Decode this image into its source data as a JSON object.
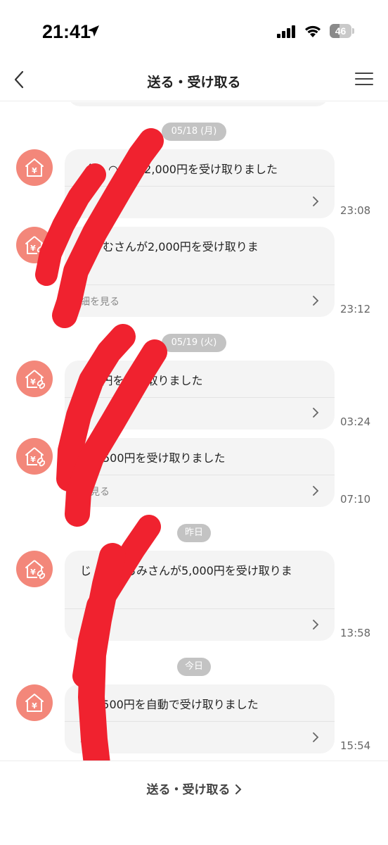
{
  "status_bar": {
    "time": "21:41",
    "battery_level": 46,
    "battery_text": "46",
    "location_icon": "location-arrow-icon",
    "signal_icon": "cellular-signal-icon",
    "wifi_icon": "wifi-icon"
  },
  "nav": {
    "title": "送る・受け取る",
    "back_icon": "chevron-left-icon",
    "menu_icon": "hamburger-menu-icon"
  },
  "colors": {
    "accent": "#f3877a",
    "card_bg": "#f4f4f4",
    "date_pill": "#c3c3c3",
    "scribble": "#f0222f"
  },
  "feed": {
    "dates": [
      "05/18 (月)",
      "05/19 (火)",
      "昨日",
      "今日"
    ],
    "messages": [
      {
        "text": "（ ◠ ◠ ）が2,000円を受け取りました",
        "link": "",
        "time": "23:08",
        "avatar_icon": "yen-house-icon"
      },
      {
        "text": "ちゃむさんが2,000円を受け取りま",
        "link": "細を見る",
        "time": "23:12",
        "avatar_icon": "yen-house-link-icon"
      },
      {
        "text": "000円を受け取りました",
        "link": "",
        "time": "03:24",
        "avatar_icon": "yen-house-link-icon"
      },
      {
        "text": "んが500円を受け取りました",
        "link": "を見る",
        "time": "07:10",
        "avatar_icon": "yen-house-link-icon"
      },
      {
        "text": "じ　　　らみさんが5,000円を受け取りま",
        "link": "る",
        "time": "13:58",
        "avatar_icon": "yen-house-link-icon"
      },
      {
        "text": "が1,500円を自動で受け取りました",
        "link": "見る",
        "time": "15:54",
        "avatar_icon": "yen-house-icon"
      }
    ]
  },
  "bottom": {
    "link_label": "送る・受け取る"
  }
}
